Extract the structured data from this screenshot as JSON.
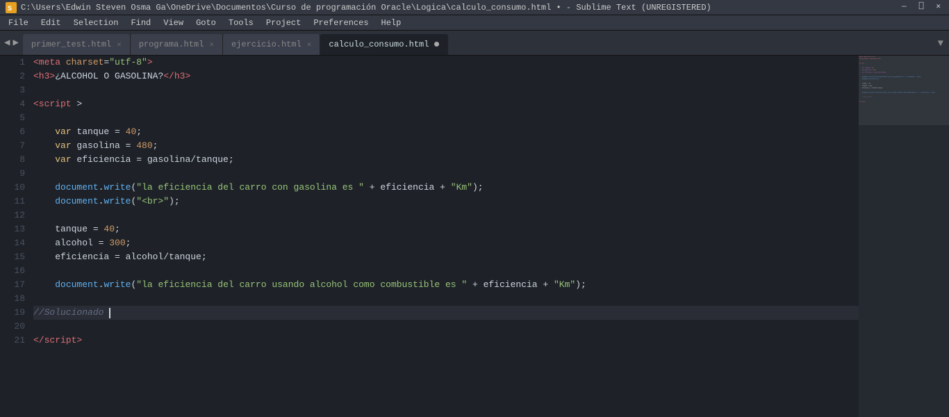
{
  "titlebar": {
    "path": "C:\\Users\\Edwin Steven Osma Ga\\OneDrive\\Documentos\\Curso de programación Oracle\\Logica\\calculo_consumo.html",
    "app": "Sublime Text (UNREGISTERED)",
    "full_title": "C:\\Users\\Edwin Steven Osma Ga\\OneDrive\\Documentos\\Curso de programación Oracle\\Logica\\calculo_consumo.html • - Sublime Text (UNREGISTERED)"
  },
  "menu": {
    "items": [
      "File",
      "Edit",
      "Selection",
      "Find",
      "View",
      "Goto",
      "Tools",
      "Project",
      "Preferences",
      "Help"
    ]
  },
  "tabs": [
    {
      "label": "primer_test.html",
      "active": false,
      "dirty": false
    },
    {
      "label": "programa.html",
      "active": false,
      "dirty": false
    },
    {
      "label": "ejercicio.html",
      "active": false,
      "dirty": false
    },
    {
      "label": "calculo_consumo.html",
      "active": true,
      "dirty": true
    }
  ],
  "lines": [
    {
      "num": 1,
      "content": "meta_tag"
    },
    {
      "num": 2,
      "content": "h3_tag"
    },
    {
      "num": 3,
      "content": "empty"
    },
    {
      "num": 4,
      "content": "script_open"
    },
    {
      "num": 5,
      "content": "empty"
    },
    {
      "num": 6,
      "content": "var_tanque"
    },
    {
      "num": 7,
      "content": "var_gasolina"
    },
    {
      "num": 8,
      "content": "var_eficiencia"
    },
    {
      "num": 9,
      "content": "empty"
    },
    {
      "num": 10,
      "content": "doc_write_gasolina"
    },
    {
      "num": 11,
      "content": "doc_write_br"
    },
    {
      "num": 12,
      "content": "empty"
    },
    {
      "num": 13,
      "content": "tanque_assign"
    },
    {
      "num": 14,
      "content": "alcohol_assign"
    },
    {
      "num": 15,
      "content": "eficiencia_assign"
    },
    {
      "num": 16,
      "content": "empty"
    },
    {
      "num": 17,
      "content": "doc_write_alcohol"
    },
    {
      "num": 18,
      "content": "empty"
    },
    {
      "num": 19,
      "content": "comment_solucionado"
    },
    {
      "num": 20,
      "content": "empty"
    },
    {
      "num": 21,
      "content": "script_close"
    }
  ]
}
